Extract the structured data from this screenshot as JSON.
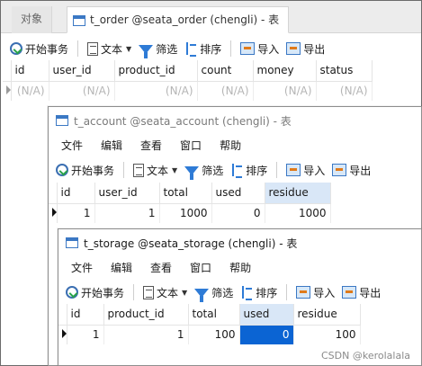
{
  "back_window": {
    "tabs": [
      {
        "label": "对象"
      },
      {
        "label": "t_order @seata_order (chengli) - 表"
      }
    ],
    "toolbar": {
      "begin_tx": "开始事务",
      "text": "文本",
      "filter": "筛选",
      "sort": "排序",
      "import": "导入",
      "export": "导出"
    },
    "grid": {
      "columns": [
        "id",
        "user_id",
        "product_id",
        "count",
        "money",
        "status"
      ],
      "row": [
        "(N/A)",
        "(N/A)",
        "(N/A)",
        "(N/A)",
        "(N/A)",
        "(N/A)"
      ]
    }
  },
  "account_window": {
    "title": "t_account @seata_account (chengli) - 表",
    "menu": [
      "文件",
      "编辑",
      "查看",
      "窗口",
      "帮助"
    ],
    "toolbar": {
      "begin_tx": "开始事务",
      "text": "文本",
      "filter": "筛选",
      "sort": "排序",
      "import": "导入",
      "export": "导出"
    },
    "grid": {
      "columns": [
        "id",
        "user_id",
        "total",
        "used",
        "residue"
      ],
      "row": [
        "1",
        "1",
        "1000",
        "0",
        "1000"
      ]
    }
  },
  "storage_window": {
    "title": "t_storage @seata_storage (chengli) - 表",
    "menu": [
      "文件",
      "编辑",
      "查看",
      "窗口",
      "帮助"
    ],
    "toolbar": {
      "begin_tx": "开始事务",
      "text": "文本",
      "filter": "筛选",
      "sort": "排序",
      "import": "导入",
      "export": "导出"
    },
    "grid": {
      "columns": [
        "id",
        "product_id",
        "total",
        "used",
        "residue"
      ],
      "row": [
        "1",
        "1",
        "100",
        "0",
        "100"
      ]
    }
  },
  "watermark": "CSDN @kerolalala",
  "colors": {
    "selection": "#0b64d3",
    "selected_header": "#d9e7f7",
    "icon_blue": "#2e7bd6"
  }
}
